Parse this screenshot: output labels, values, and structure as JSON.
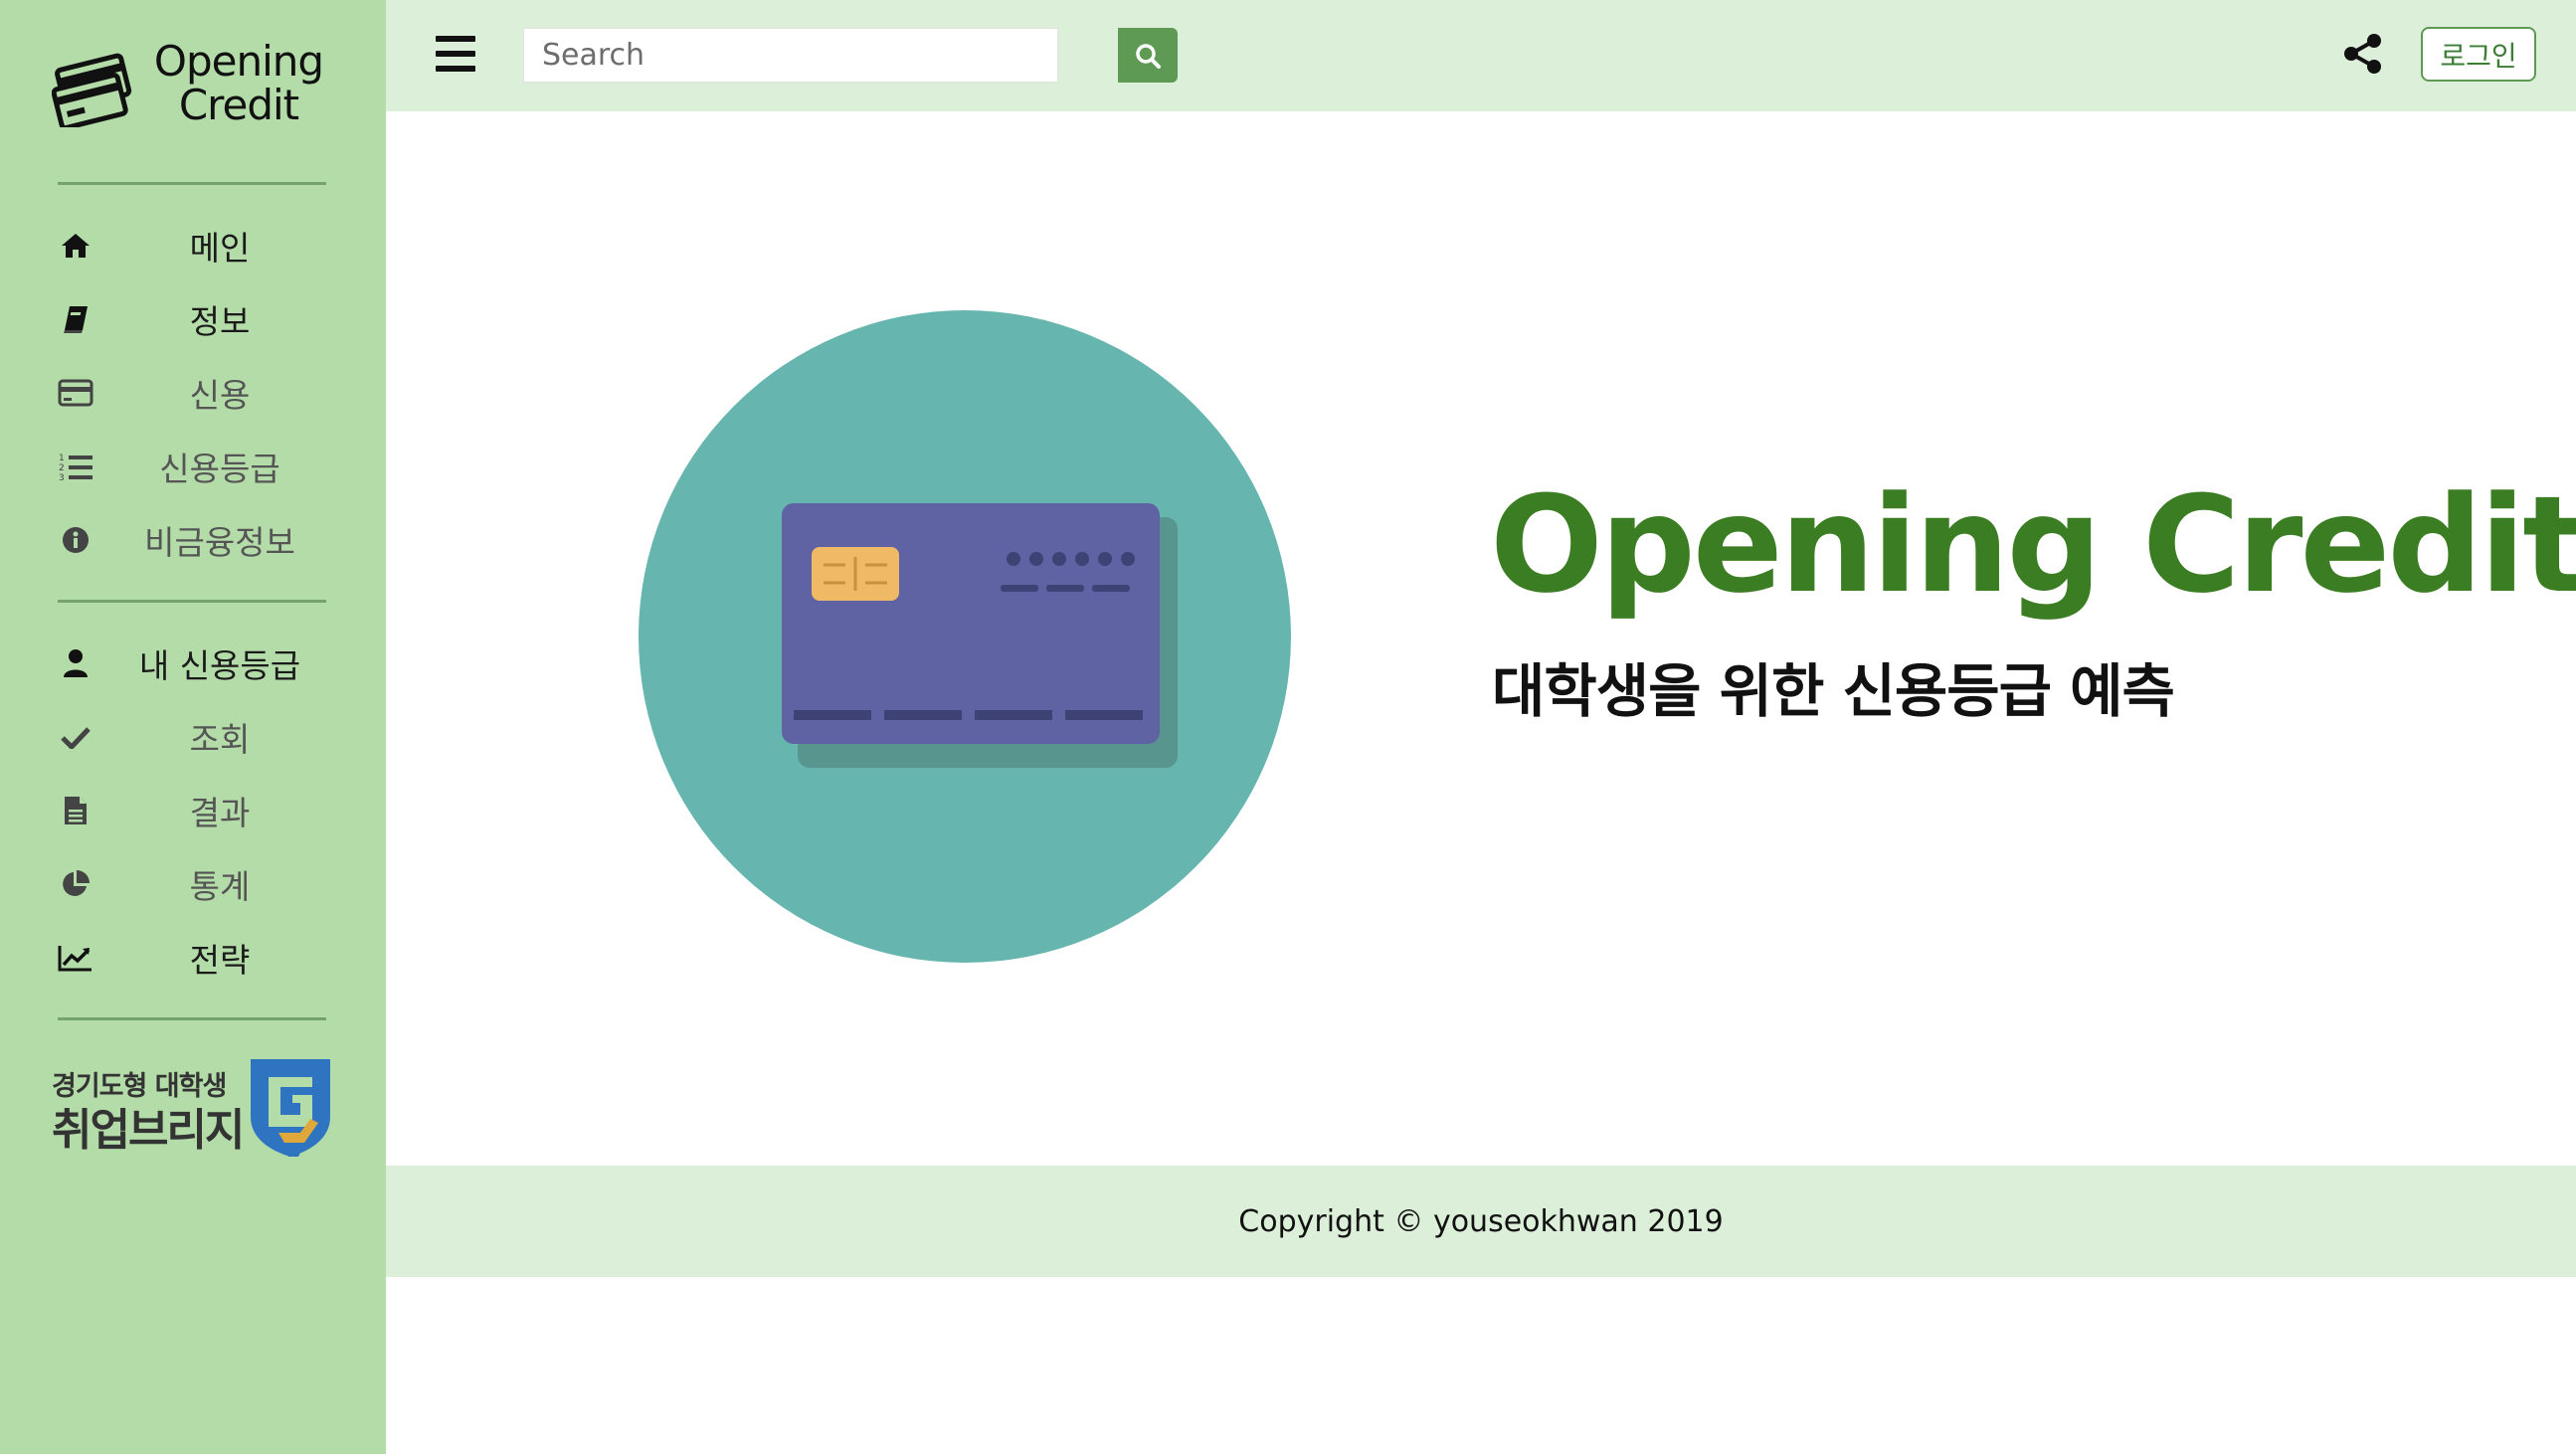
{
  "brand": {
    "logo_line1": "Opening",
    "logo_line2": "Credit"
  },
  "sidebar": {
    "group1": [
      {
        "label": "메인",
        "icon": "home-icon"
      },
      {
        "label": "정보",
        "icon": "book-icon"
      },
      {
        "label": "신용",
        "icon": "credit-card-icon"
      },
      {
        "label": "신용등급",
        "icon": "numbered-list-icon"
      },
      {
        "label": "비금융정보",
        "icon": "info-icon"
      }
    ],
    "group2": [
      {
        "label": "내 신용등급",
        "icon": "user-icon"
      },
      {
        "label": "조회",
        "icon": "check-icon"
      },
      {
        "label": "결과",
        "icon": "document-icon"
      },
      {
        "label": "통계",
        "icon": "pie-chart-icon"
      },
      {
        "label": "전략",
        "icon": "line-chart-icon"
      }
    ],
    "partner": {
      "line1": "경기도형 대학생",
      "line2": "취업브리지"
    }
  },
  "topbar": {
    "search_placeholder": "Search",
    "login_label": "로그인"
  },
  "hero": {
    "title": "Opening Credit",
    "subtitle": "대학생을 위한 신용등급 예측"
  },
  "footer": {
    "copyright": "Copyright © youseokhwan 2019"
  },
  "colors": {
    "sidebar_bg": "#b4dca8",
    "topbar_bg": "#dcefd8",
    "accent_green": "#3b7d22",
    "button_green": "#5e9a54",
    "circle_teal": "#66b5ae",
    "card_purple": "#5f62a3"
  }
}
